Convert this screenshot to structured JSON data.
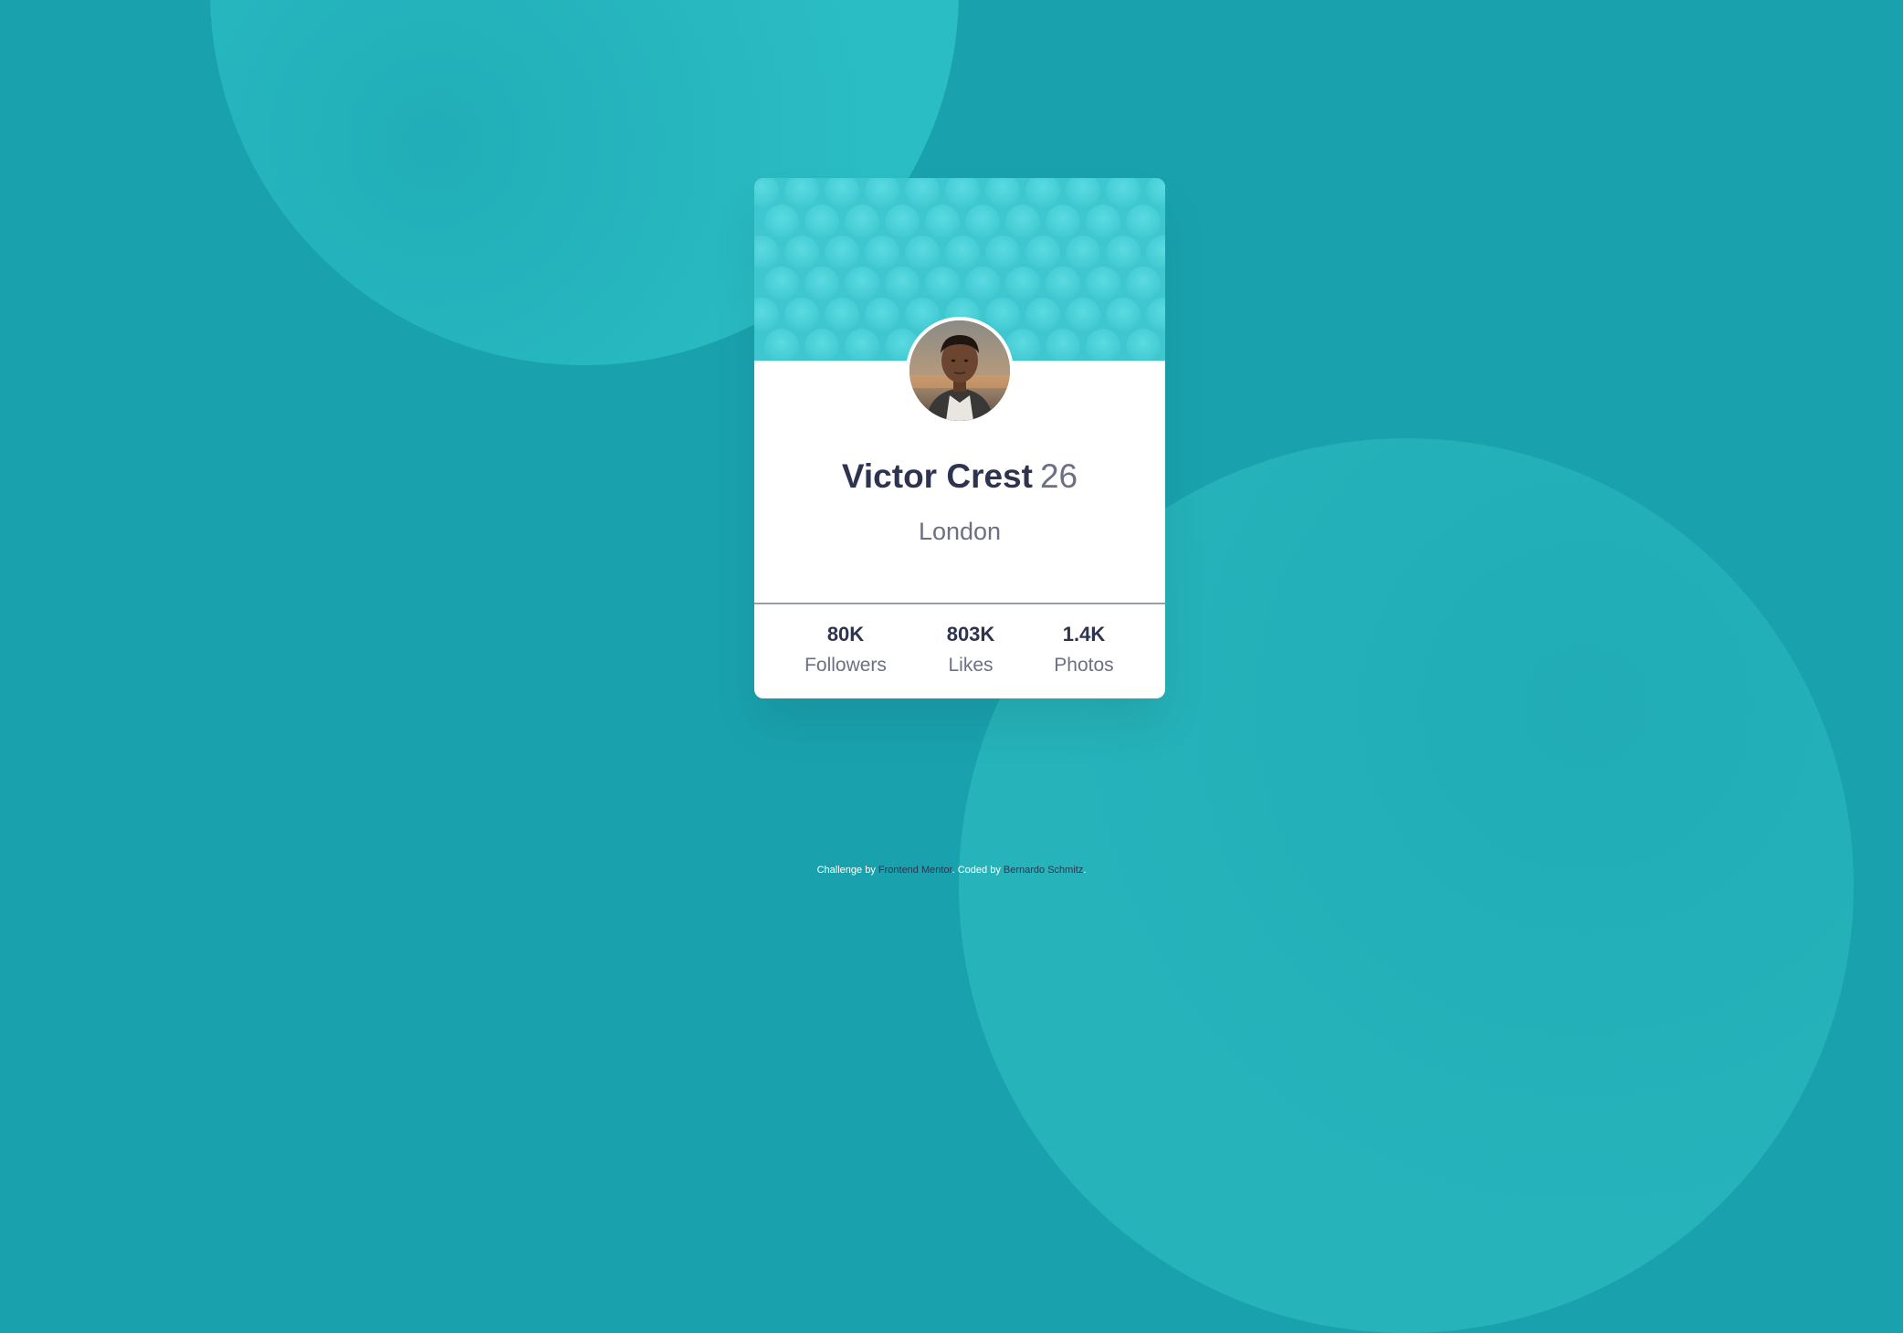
{
  "profile": {
    "name": "Victor Crest",
    "age": "26",
    "city": "London"
  },
  "stats": [
    {
      "value": "80K",
      "label": "Followers"
    },
    {
      "value": "803K",
      "label": "Likes"
    },
    {
      "value": "1.4K",
      "label": "Photos"
    }
  ],
  "attribution": {
    "challenge_prefix": "Challenge by",
    "challenge_link": "Frontend Mentor",
    "coded_prefix": "Coded by",
    "coded_link": "Bernardo Schmitz"
  },
  "colors": {
    "background": "#19a2ae",
    "header": "#3fc7d0",
    "text_dark": "#2e3450",
    "text_muted": "#6b7082"
  }
}
